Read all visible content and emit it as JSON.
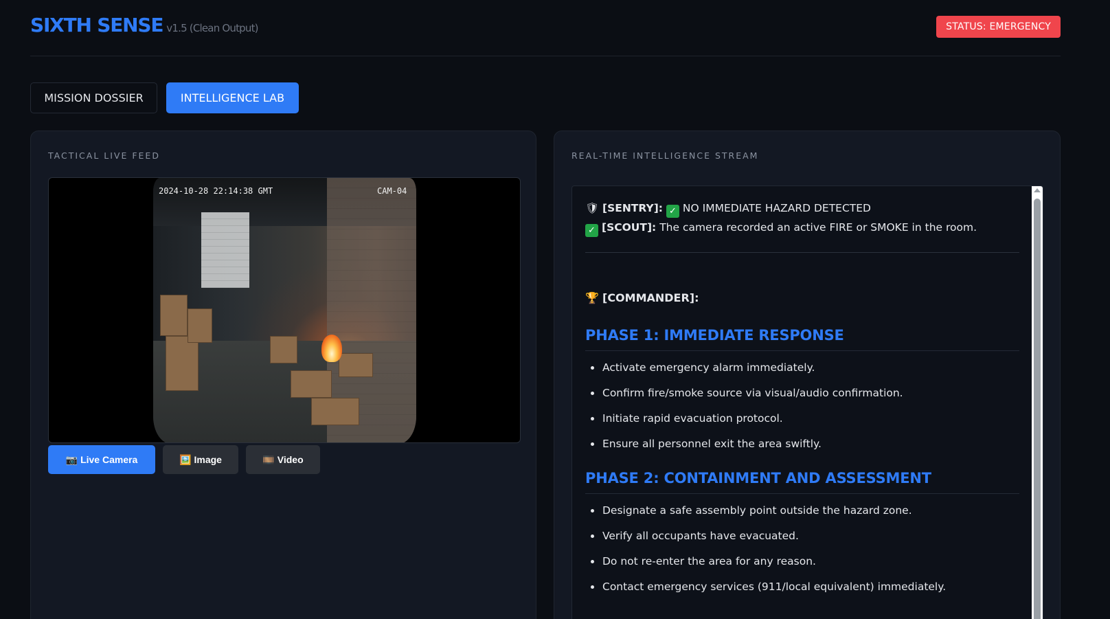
{
  "header": {
    "title": "SIXTH SENSE",
    "version": "v1.5 (Clean Output)",
    "status": "STATUS: EMERGENCY"
  },
  "tabs": [
    {
      "label": "MISSION DOSSIER",
      "active": false
    },
    {
      "label": "INTELLIGENCE LAB",
      "active": true
    }
  ],
  "feed_panel": {
    "label": "TACTICAL LIVE FEED",
    "camera": {
      "timestamp": "2024-10-28 22:14:38 GMT",
      "camera_id": "CAM-04"
    },
    "sources": [
      {
        "icon": "camera-icon",
        "glyph": "📷",
        "label": "Live Camera",
        "active": true
      },
      {
        "icon": "image-icon",
        "glyph": "🖼️",
        "label": "Image",
        "active": false
      },
      {
        "icon": "film-icon",
        "glyph": "🎞️",
        "label": "Video",
        "active": false
      }
    ]
  },
  "stream_panel": {
    "label": "REAL-TIME INTELLIGENCE STREAM",
    "sentry": {
      "tag": "[SENTRY]:",
      "message": "NO IMMEDIATE HAZARD DETECTED"
    },
    "scout": {
      "tag": "[SCOUT]:",
      "message": "The camera recorded an active FIRE or SMOKE in the room."
    },
    "commander": {
      "tag": "[COMMANDER]:"
    },
    "phases": [
      {
        "title": "PHASE 1: IMMEDIATE RESPONSE",
        "steps": [
          "Activate emergency alarm immediately.",
          "Confirm fire/smoke source via visual/audio confirmation.",
          "Initiate rapid evacuation protocol.",
          "Ensure all personnel exit the area swiftly."
        ]
      },
      {
        "title": "PHASE 2: CONTAINMENT AND ASSESSMENT",
        "steps": [
          "Designate a safe assembly point outside the hazard zone.",
          "Verify all occupants have evacuated.",
          "Do not re-enter the area for any reason.",
          "Contact emergency services (911/local equivalent) immediately."
        ]
      }
    ]
  },
  "colors": {
    "accent": "#2f7bf6",
    "status_bg": "#f0454c",
    "background": "#0b0e14",
    "panel": "#131823"
  }
}
